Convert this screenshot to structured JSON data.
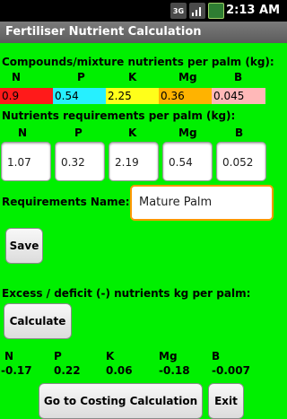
{
  "status_bar": {
    "network": "3G",
    "time": "2:13 AM"
  },
  "app_title": "Fertiliser Nutrient Calculation",
  "compounds_label": "Compounds/mixture nutrients per palm (kg):",
  "nutrient_headers": [
    "N",
    "P",
    "K",
    "Mg",
    "B"
  ],
  "compounds": [
    {
      "value": "0.9",
      "color": "#ff1a1a"
    },
    {
      "value": "0.54",
      "color": "#26f0ff"
    },
    {
      "value": "2.25",
      "color": "#ffff1a"
    },
    {
      "value": "0.36",
      "color": "#ffb300"
    },
    {
      "value": "0.045",
      "color": "#ffb8b8"
    }
  ],
  "requirements_label": "Nutrients requirements per palm (kg):",
  "requirements": [
    "1.07",
    "0.32",
    "2.19",
    "0.54",
    "0.052"
  ],
  "requirements_name_label": "Requirements Name:",
  "requirements_name_value": "Mature Palm",
  "save_button": "Save",
  "excess_label": "Excess / deficit (-) nutrients kg per palm:",
  "calculate_button": "Calculate",
  "results": [
    "-0.17",
    "0.22",
    "0.06",
    "-0.18",
    "-0.007"
  ],
  "costing_button": "Go to Costing Calculation",
  "exit_button": "Exit"
}
